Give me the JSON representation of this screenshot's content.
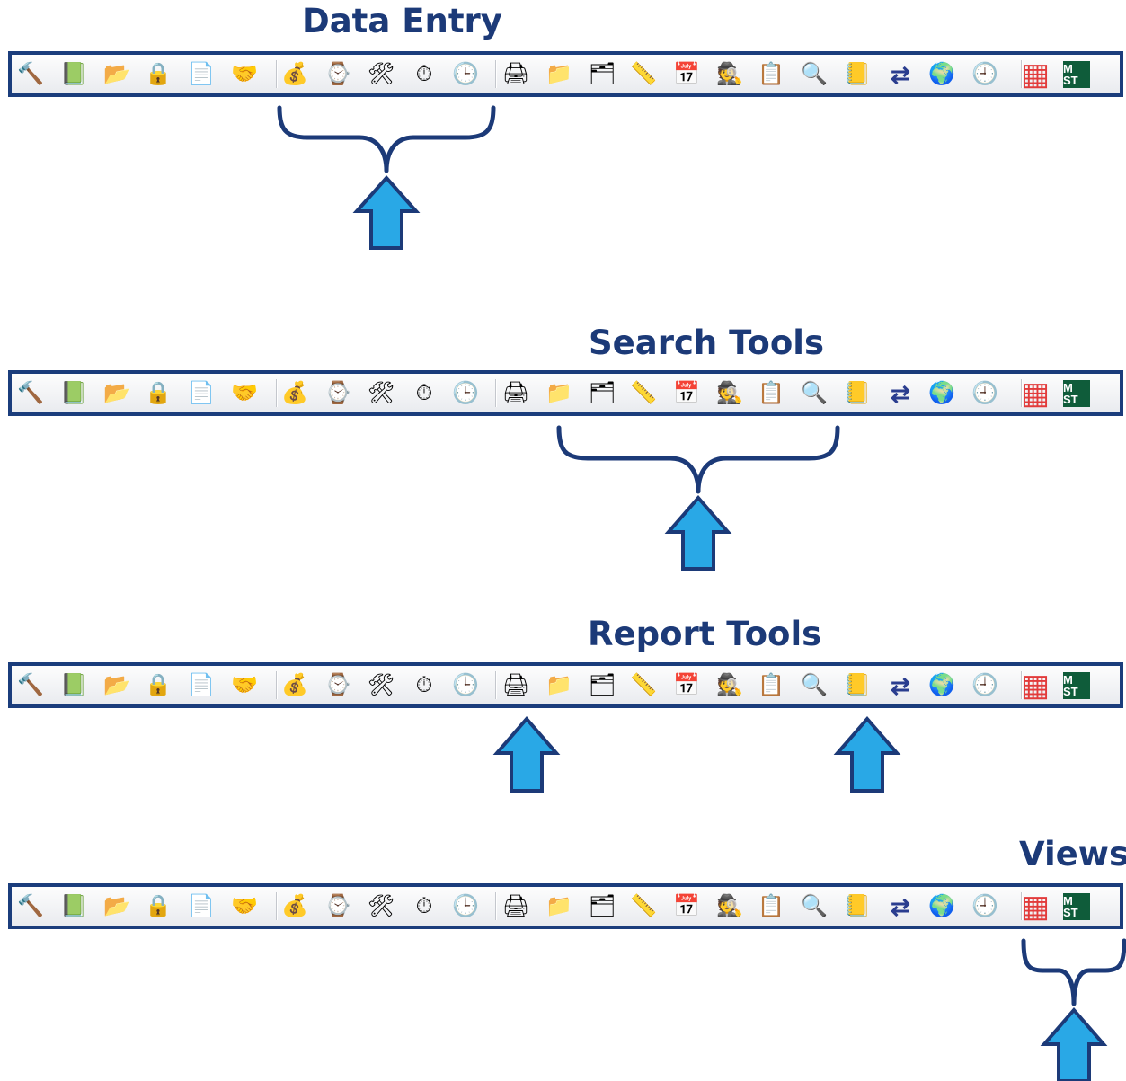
{
  "sections": [
    {
      "title": "Data Entry"
    },
    {
      "title": "Search Tools"
    },
    {
      "title": "Report Tools"
    },
    {
      "title": "Views"
    }
  ],
  "toolbar": {
    "icons": [
      {
        "name": "gavel-icon",
        "glyph": "🔨"
      },
      {
        "name": "map-book-icon",
        "glyph": "📗"
      },
      {
        "name": "file-folder-icon",
        "glyph": "📂"
      },
      {
        "name": "padlock-icon",
        "glyph": "🔒"
      },
      {
        "name": "hand-document-icon",
        "glyph": "📄"
      },
      {
        "name": "handshake-icon",
        "glyph": "🤝"
      },
      {
        "name": "money-bag-icon",
        "glyph": "💰"
      },
      {
        "name": "wristwatch-icon",
        "glyph": "⌚"
      },
      {
        "name": "tools-icon",
        "glyph": "🛠"
      },
      {
        "name": "stopwatch-icon",
        "glyph": "⏱"
      },
      {
        "name": "clock-document-icon",
        "glyph": "🕒"
      },
      {
        "name": "printer-icon",
        "glyph": "🖨"
      },
      {
        "name": "folder-icon",
        "glyph": "📁"
      },
      {
        "name": "folder-search-icon",
        "glyph": "🗂"
      },
      {
        "name": "ruler-pencil-icon",
        "glyph": "📏"
      },
      {
        "name": "desk-calendar-icon",
        "glyph": "📅"
      },
      {
        "name": "person-search-icon",
        "glyph": "🕵"
      },
      {
        "name": "clipboard-icon",
        "glyph": "📋"
      },
      {
        "name": "document-search-icon",
        "glyph": "🔍"
      },
      {
        "name": "contact-book-icon",
        "glyph": "📒"
      },
      {
        "name": "double-arrow-icon",
        "glyph": "⇄"
      },
      {
        "name": "globe-icon",
        "glyph": "🌍"
      },
      {
        "name": "clock-calendar-icon",
        "glyph": "🕘"
      },
      {
        "name": "tile-view-icon",
        "glyph": "▦"
      },
      {
        "name": "mst-icon",
        "glyph": "M ST"
      }
    ]
  },
  "colors": {
    "annotation_blue": "#1c3a78",
    "arrow_fill": "#29a8e6",
    "toolbar_border": "#1b3d7c"
  }
}
